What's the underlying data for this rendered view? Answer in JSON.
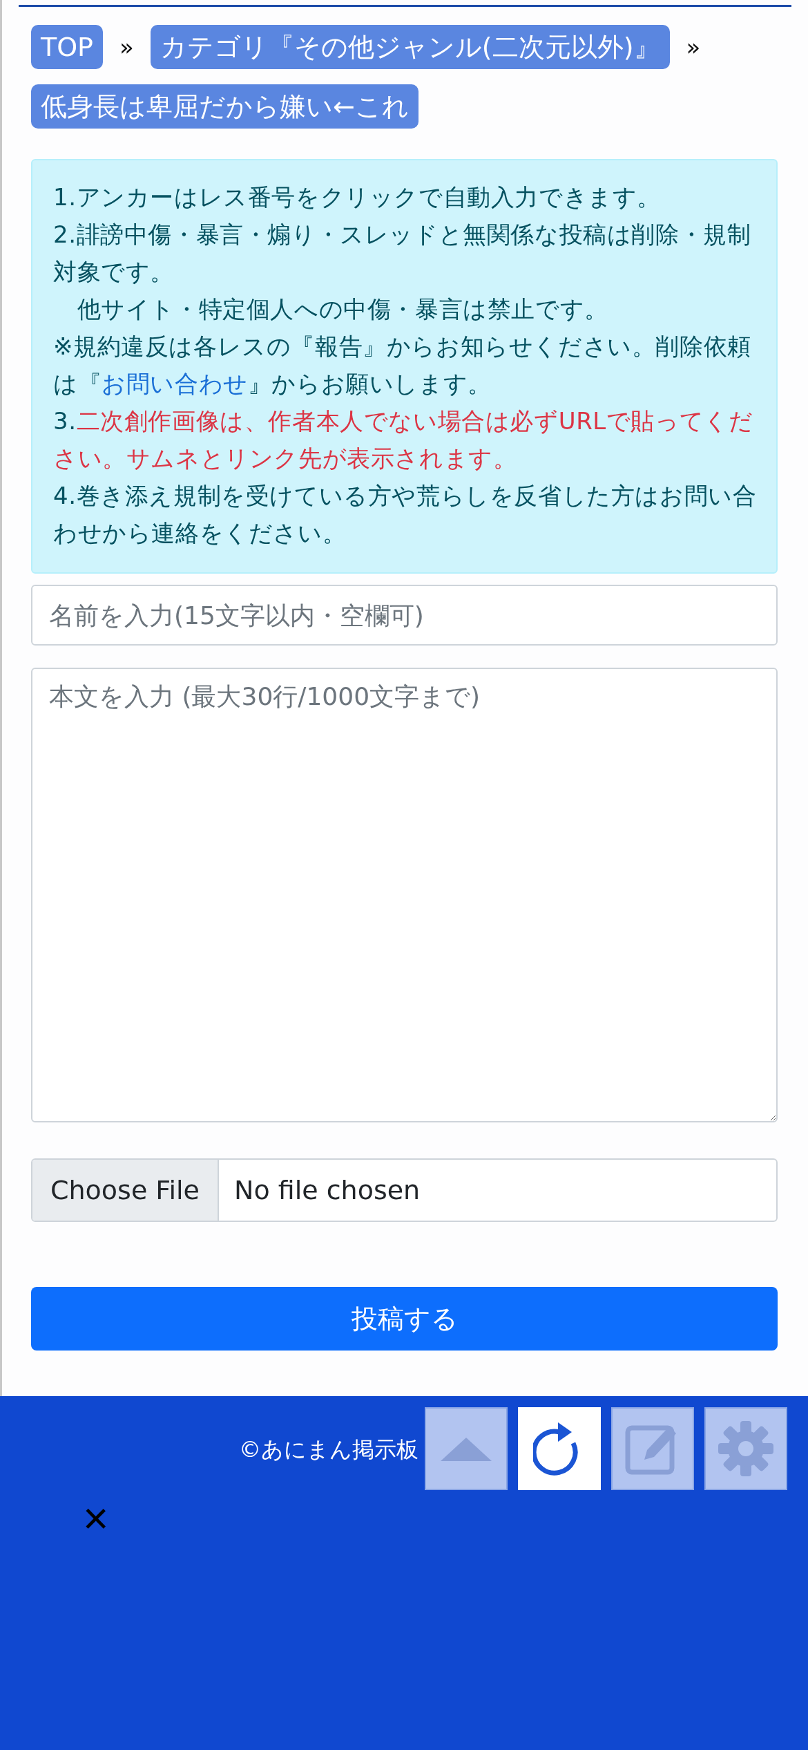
{
  "breadcrumb": {
    "items": [
      {
        "label": "TOP"
      },
      {
        "label": "カテゴリ『その他ジャンル(二次元以外)』"
      },
      {
        "label": "低身長は卑屈だから嫌い←これ"
      }
    ],
    "separator": "»"
  },
  "notice": {
    "paragraphs": [
      [
        {
          "kind": "plain",
          "text": "1.アンカーはレス番号をクリックで自動入力できます。"
        }
      ],
      [
        {
          "kind": "plain",
          "text": "2.誹謗中傷・暴言・煽り・スレッドと無関係な投稿は削除・規制対象です。"
        }
      ],
      [
        {
          "kind": "plain",
          "text": "　他サイト・特定個人への中傷・暴言は禁止です。"
        }
      ],
      [
        {
          "kind": "plain",
          "text": "※規約違反は各レスの『報告』からお知らせください。削除依頼は『"
        },
        {
          "kind": "link",
          "text": "お問い合わせ"
        },
        {
          "kind": "plain",
          "text": "』からお願いします。"
        }
      ],
      [
        {
          "kind": "plain",
          "text": "3."
        },
        {
          "kind": "alert",
          "text": "二次創作画像は、作者本人でない場合は必ずURLで貼ってください。サムネとリンク先が表示されます。"
        }
      ],
      [
        {
          "kind": "plain",
          "text": "4.巻き添え規制を受けている方や荒らしを反省した方はお問い合わせから連絡をください。"
        }
      ]
    ]
  },
  "form": {
    "name_placeholder": "名前を入力(15文字以内・空欄可)",
    "body_placeholder": "本文を入力 (最大30行/1000文字まで)",
    "file_button": "Choose File",
    "file_status": "No file chosen",
    "submit": "投稿する"
  },
  "footer": {
    "copyright": "©あにまん掲示板",
    "close": "×"
  },
  "floating_buttons": [
    {
      "kind": "up",
      "selected": false
    },
    {
      "kind": "reload",
      "selected": true
    },
    {
      "kind": "write",
      "selected": false
    },
    {
      "kind": "settings",
      "selected": false
    }
  ]
}
